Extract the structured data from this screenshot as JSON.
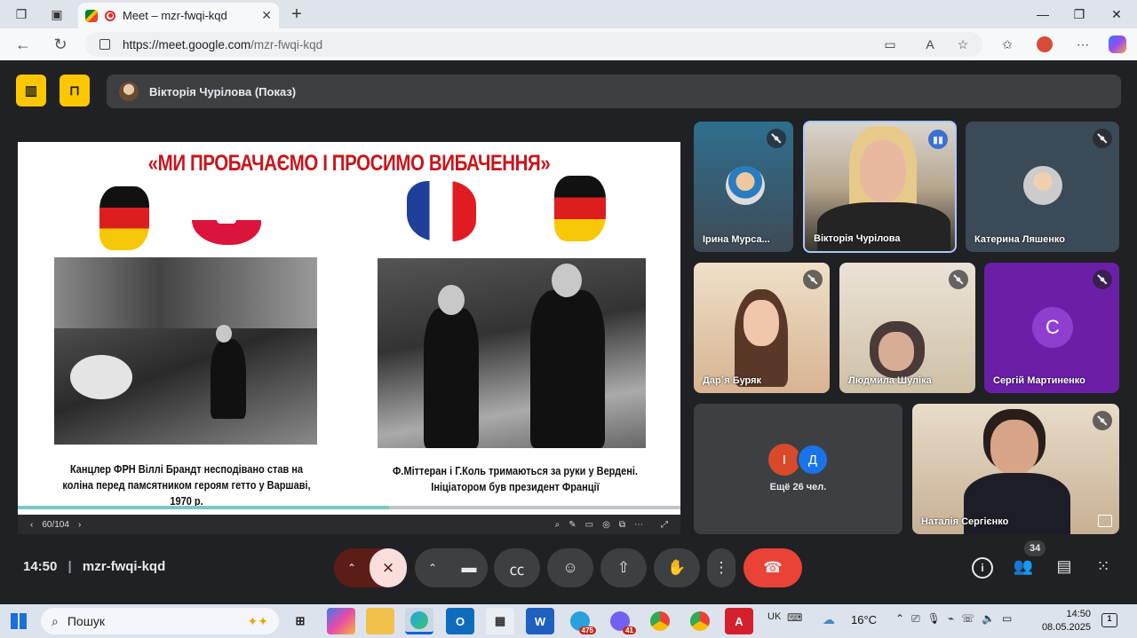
{
  "browser": {
    "tab_title": "Meet – mzr-fwqi-kqd",
    "url_host": "https://meet.google.com",
    "url_path": "/mzr-fwqi-kqd"
  },
  "meet": {
    "presenter_label": "Вікторія Чурілова (Показ)",
    "slide": {
      "title": "«МИ ПРОБАЧАЄМО І ПРОСИМО ВИБАЧЕННЯ»",
      "caption_left_1": "Канцлер ФРН Віллі Брандт  несподівано став на",
      "caption_left_2": "коліна перед памсятником героям гетто у Варшаві,",
      "caption_left_3": "1970 р.",
      "caption_right_1": "Ф.Міттеран і Г.Коль тримаються за руки у Вердені.",
      "caption_right_2": "Ініціатором був президент Франції",
      "page_counter": "60/104",
      "progress": 0.56
    },
    "participants": [
      {
        "name": "Ірина Мурса..."
      },
      {
        "name": "Вікторія Чурілова"
      },
      {
        "name": "Катерина Ляшенко"
      },
      {
        "name": "Дар`я Буряк"
      },
      {
        "name": "Людмила Шуліка"
      },
      {
        "name": "Сергій Мартиненко",
        "initial": "С"
      },
      {
        "name": "Наталія Сергієнко"
      }
    ],
    "others": {
      "initial_1": "І",
      "initial_2": "Д",
      "label": "Ещё 26 чел."
    },
    "time": "14:50",
    "meeting_code": "mzr-fwqi-kqd",
    "people_count": "34",
    "colors": {
      "end_call": "#ea4335",
      "mic_off": "#f9dedc",
      "accent": "#fdc700"
    }
  },
  "taskbar": {
    "search_placeholder": "Пошук",
    "lang": "UK",
    "temperature": "16°C",
    "time": "14:50",
    "date": "08.05.2025",
    "telegram_badge": "475",
    "viber_badge": "41",
    "notif_count": "1"
  }
}
